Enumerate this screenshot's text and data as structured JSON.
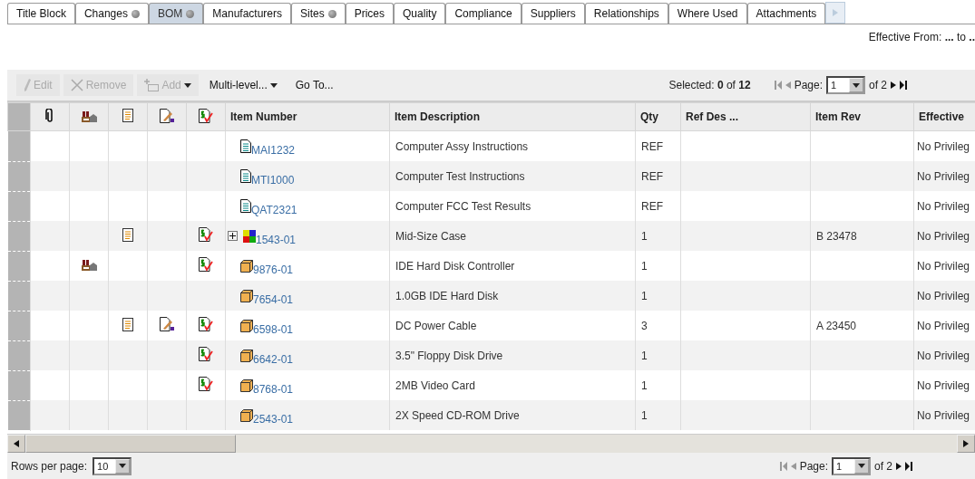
{
  "tabs": [
    {
      "label": "Title Block",
      "selected": false,
      "indicator": false
    },
    {
      "label": "Changes",
      "selected": false,
      "indicator": true
    },
    {
      "label": "BOM",
      "selected": true,
      "indicator": true
    },
    {
      "label": "Manufacturers",
      "selected": false,
      "indicator": false
    },
    {
      "label": "Sites",
      "selected": false,
      "indicator": true
    },
    {
      "label": "Prices",
      "selected": false,
      "indicator": false
    },
    {
      "label": "Quality",
      "selected": false,
      "indicator": false
    },
    {
      "label": "Compliance",
      "selected": false,
      "indicator": false
    },
    {
      "label": "Suppliers",
      "selected": false,
      "indicator": false
    },
    {
      "label": "Relationships",
      "selected": false,
      "indicator": false
    },
    {
      "label": "Where Used",
      "selected": false,
      "indicator": false
    },
    {
      "label": "Attachments",
      "selected": false,
      "indicator": false
    }
  ],
  "effective": "Effective From: **...** to **..**",
  "toolbar": [
    {
      "kind": "edit",
      "label": "Edit",
      "disabled": true
    },
    {
      "kind": "remove",
      "label": "Remove",
      "disabled": true
    },
    {
      "kind": "add",
      "label": "Add",
      "disabled": true
    },
    {
      "kind": "menu",
      "label": "Multi-level...",
      "disabled": false
    },
    {
      "kind": "link",
      "label": "Go To...",
      "disabled": false
    }
  ],
  "selection": "Selected: **0** of **12**",
  "pagers": [
    {
      "first_disabled": true,
      "prev_disabled": true,
      "label": "Page:",
      "value": "1",
      "total": "of 2"
    },
    {
      "first_disabled": true,
      "prev_disabled": true,
      "label": "Page:",
      "value": "1",
      "total": "of 2"
    }
  ],
  "columns": [
    "Item Number",
    "Item Description",
    "Qty",
    "Ref Des ...",
    "Item Rev",
    "Effective"
  ],
  "rows": [
    {
      "attachment": false,
      "site": false,
      "redline": false,
      "change": false,
      "price": false,
      "kind": "document",
      "expandable": false,
      "number": "MAI1232",
      "description": "Computer Assy Instructions",
      "qty": "REF",
      "ref_des": "",
      "rev": "",
      "effective": "No Privileg"
    },
    {
      "attachment": false,
      "site": false,
      "redline": false,
      "change": false,
      "price": false,
      "kind": "document",
      "expandable": false,
      "number": "MTI1000",
      "description": "Computer Test Instructions",
      "qty": "REF",
      "ref_des": "",
      "rev": "",
      "effective": "No Privileg"
    },
    {
      "attachment": false,
      "site": false,
      "redline": false,
      "change": false,
      "price": false,
      "kind": "document",
      "expandable": false,
      "number": "QAT2321",
      "description": "Computer FCC Test Results",
      "qty": "REF",
      "ref_des": "",
      "rev": "",
      "effective": "No Privileg"
    },
    {
      "attachment": false,
      "site": false,
      "redline": true,
      "change": false,
      "price": true,
      "kind": "assembly",
      "expandable": true,
      "number": "1543-01",
      "description": "Mid-Size Case",
      "qty": "1",
      "ref_des": "",
      "rev": "B 23478",
      "effective": "No Privileg"
    },
    {
      "attachment": false,
      "site": true,
      "redline": false,
      "change": false,
      "price": true,
      "kind": "part",
      "expandable": false,
      "number": "9876-01",
      "description": "IDE Hard Disk Controller",
      "qty": "1",
      "ref_des": "",
      "rev": "",
      "effective": "No Privileg"
    },
    {
      "attachment": false,
      "site": false,
      "redline": false,
      "change": false,
      "price": false,
      "kind": "part",
      "expandable": false,
      "number": "7654-01",
      "description": "1.0GB IDE Hard Disk",
      "qty": "1",
      "ref_des": "",
      "rev": "",
      "effective": "No Privileg"
    },
    {
      "attachment": false,
      "site": false,
      "redline": true,
      "change": true,
      "price": true,
      "kind": "part",
      "expandable": false,
      "number": "6598-01",
      "description": "DC Power Cable",
      "qty": "3",
      "ref_des": "",
      "rev": "A 23450",
      "effective": "No Privileg"
    },
    {
      "attachment": false,
      "site": false,
      "redline": false,
      "change": false,
      "price": true,
      "kind": "part",
      "expandable": false,
      "number": "6642-01",
      "description": "3.5\" Floppy Disk Drive",
      "qty": "1",
      "ref_des": "",
      "rev": "",
      "effective": "No Privileg"
    },
    {
      "attachment": false,
      "site": false,
      "redline": false,
      "change": false,
      "price": true,
      "kind": "part",
      "expandable": false,
      "number": "8768-01",
      "description": "2MB Video Card",
      "qty": "1",
      "ref_des": "",
      "rev": "",
      "effective": "No Privileg"
    },
    {
      "attachment": false,
      "site": false,
      "redline": false,
      "change": false,
      "price": false,
      "kind": "part",
      "expandable": false,
      "number": "2543-01",
      "description": "2X Speed CD-ROM Drive",
      "qty": "1",
      "ref_des": "",
      "rev": "",
      "effective": "No Privileg"
    }
  ],
  "rows_per_page": {
    "label": "Rows per page:",
    "value": "10"
  }
}
